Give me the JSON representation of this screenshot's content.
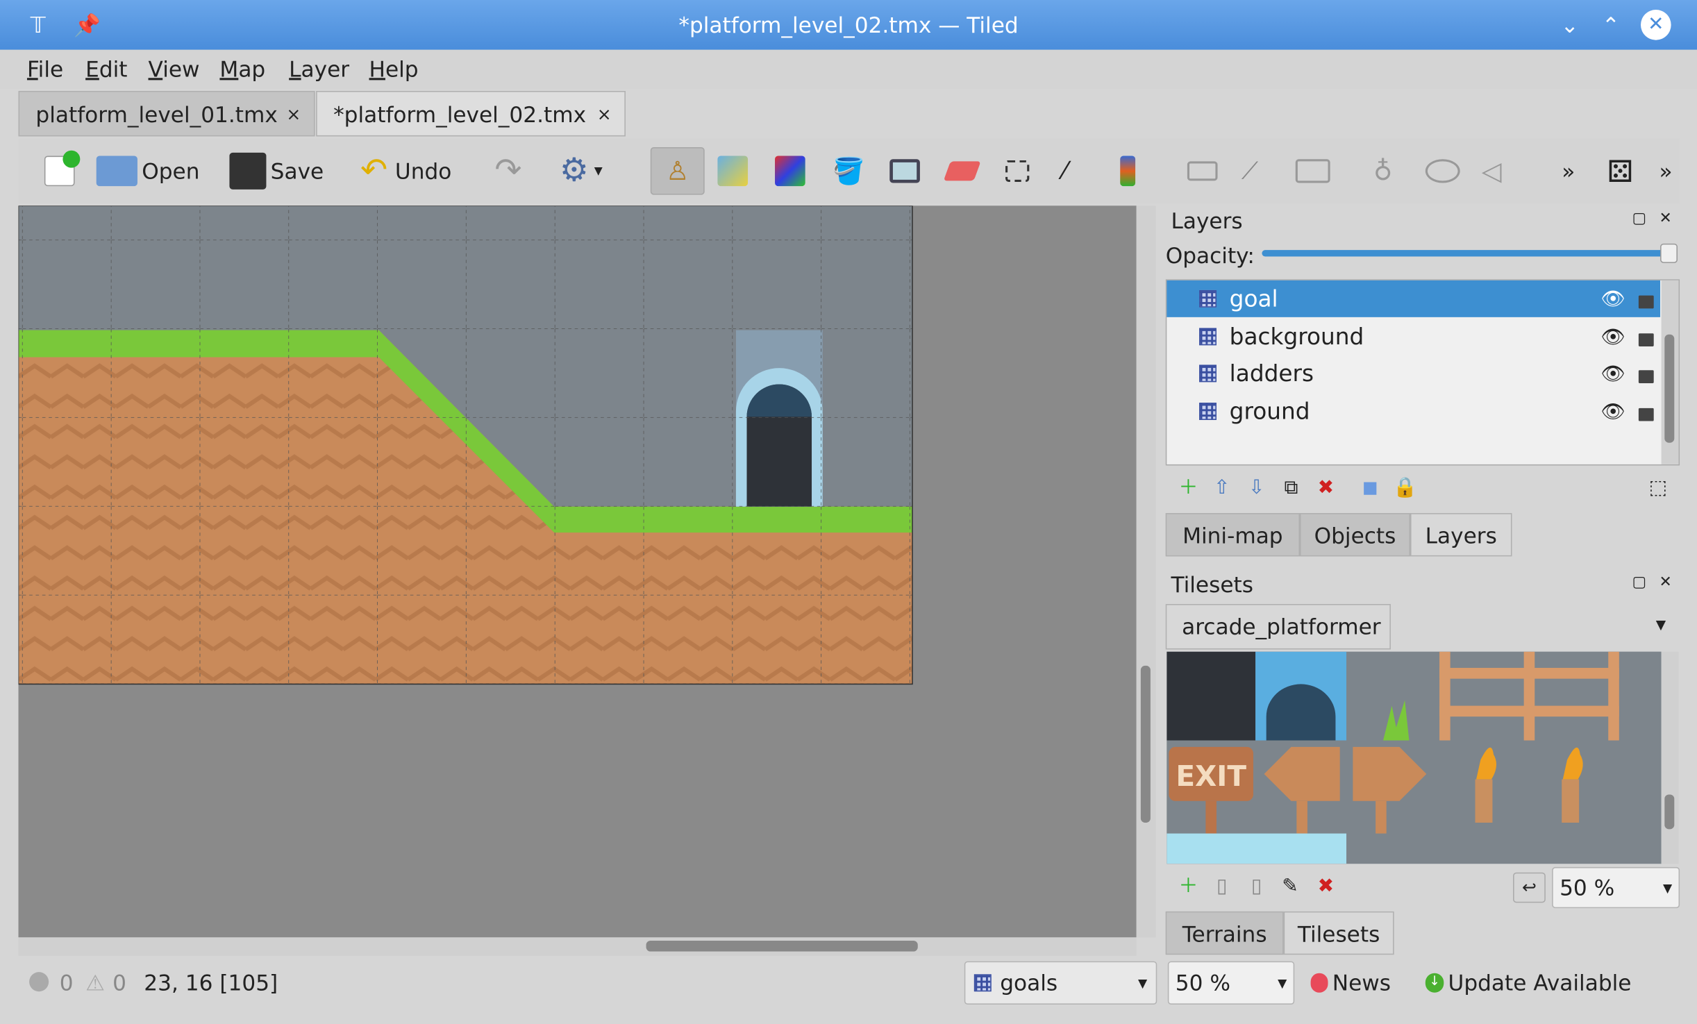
{
  "window": {
    "title": "*platform_level_02.tmx — Tiled",
    "controls": [
      "minimize",
      "maximize",
      "close"
    ]
  },
  "menu": [
    "File",
    "Edit",
    "View",
    "Map",
    "Layer",
    "Help"
  ],
  "tabs": [
    {
      "label": "platform_level_01.tmx",
      "close": "×"
    },
    {
      "label": "*platform_level_02.tmx",
      "close": "×"
    }
  ],
  "toolbar": {
    "new_label": "",
    "open_label": "Open",
    "save_label": "Save",
    "undo_label": "Undo",
    "tools": [
      "stamp-brush",
      "terrain-brush",
      "wang-brush",
      "bucket-fill",
      "shape-fill",
      "eraser",
      "rect-select",
      "magic-wand",
      "select-same-tile",
      "object-select",
      "edit-polygons",
      "insert-rectangle",
      "insert-point",
      "insert-ellipse",
      "insert-polygon",
      "random-mode"
    ]
  },
  "layers_panel": {
    "title": "Layers",
    "opacity_label": "Opacity:",
    "opacity": 1.0,
    "layers": [
      {
        "name": "goal",
        "selected": true
      },
      {
        "name": "background"
      },
      {
        "name": "ladders"
      },
      {
        "name": "ground"
      }
    ],
    "tabs": [
      "Mini-map",
      "Objects",
      "Layers"
    ],
    "active_tab": "Layers"
  },
  "tilesets_panel": {
    "title": "Tilesets",
    "tileset": "arcade_platformer",
    "exit_sign": "EXIT",
    "zoom": "50 %",
    "tabs": [
      "Terrains",
      "Tilesets"
    ],
    "active_tab": "Tilesets"
  },
  "status": {
    "errors": "0",
    "warnings": "0",
    "coords": "23, 16 [105]",
    "layer": "goals",
    "zoom": "50 %",
    "news": "News",
    "update": "Update Available"
  },
  "colors": {
    "accent": "#3d8fd1",
    "grass": "#7ac83a",
    "dirt": "#c98a5a"
  }
}
